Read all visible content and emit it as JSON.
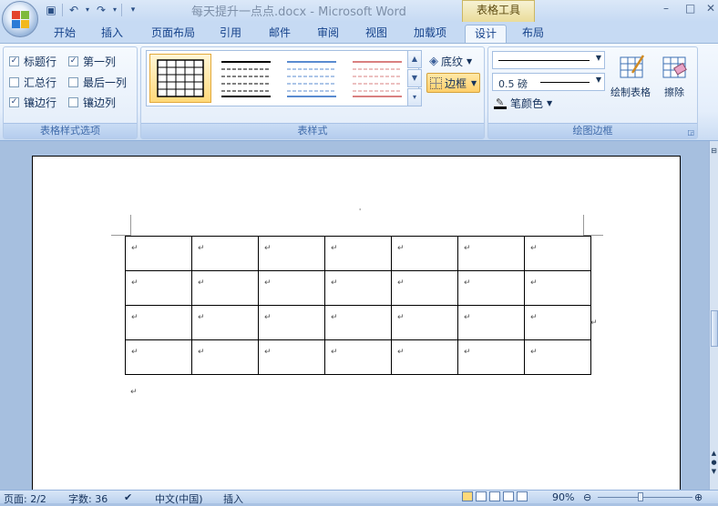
{
  "window": {
    "title": "每天提升一点点.docx - Microsoft Word",
    "context_tab_title": "表格工具",
    "min_label": "–",
    "max_label": "□",
    "close_label": "✕"
  },
  "quick_access": {
    "save_icon": "save-icon",
    "undo_icon": "undo-icon",
    "redo_icon": "redo-icon",
    "customize_icon": "chevron-down-icon"
  },
  "tabs": [
    "开始",
    "插入",
    "页面布局",
    "引用",
    "邮件",
    "审阅",
    "视图",
    "加载项",
    "设计",
    "布局"
  ],
  "active_tab": "设计",
  "ribbon": {
    "options_group": {
      "label": "表格样式选项",
      "items": [
        {
          "label": "标题行",
          "checked": true
        },
        {
          "label": "第一列",
          "checked": true
        },
        {
          "label": "汇总行",
          "checked": false
        },
        {
          "label": "最后一列",
          "checked": false
        },
        {
          "label": "镶边行",
          "checked": true
        },
        {
          "label": "镶边列",
          "checked": false
        }
      ]
    },
    "styles_group": {
      "label": "表样式",
      "shading_label": "底纹",
      "borders_label": "边框"
    },
    "draw_group": {
      "label": "绘图边框",
      "weight_value": "0.5 磅",
      "pen_color_label": "笔颜色",
      "draw_table_label": "绘制表格",
      "eraser_label": "擦除"
    },
    "colors": {
      "highlight": "#ffcf6b",
      "pen_red": "#d9302c",
      "style3": "#5a8bd0",
      "style4": "#d98080"
    }
  },
  "document": {
    "cursor_mark": "'",
    "paragraph_mark": "↵",
    "table": {
      "rows": 4,
      "cols": 7
    }
  },
  "status": {
    "page": "页面: 2/2",
    "words": "字数: 36",
    "language": "中文(中国)",
    "mode": "插入",
    "zoom": "90%"
  }
}
